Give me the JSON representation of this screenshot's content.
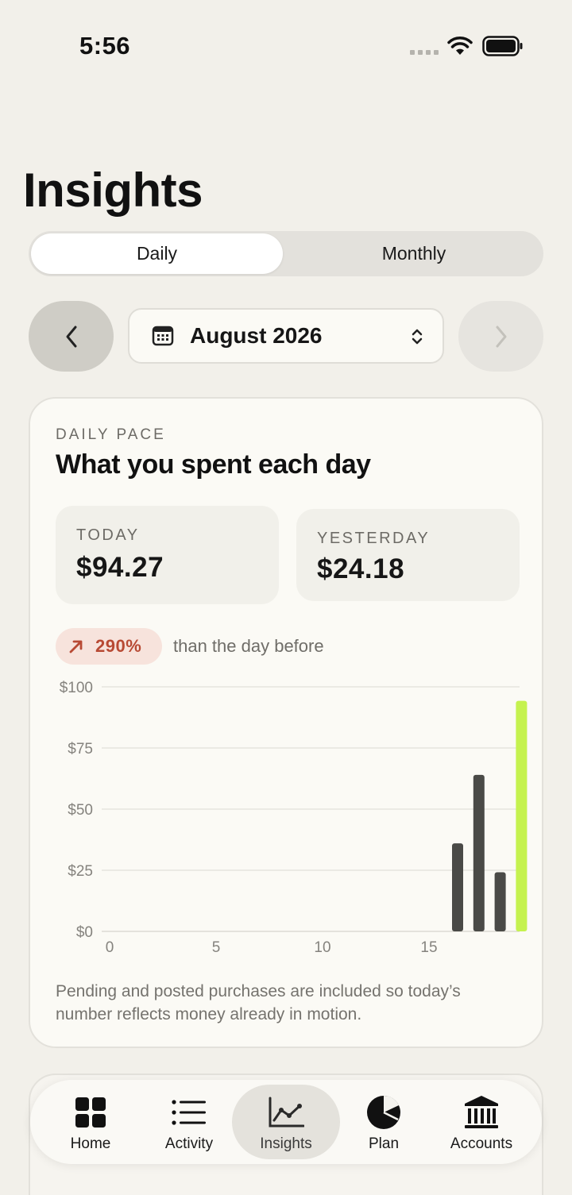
{
  "status_bar": {
    "time": "5:56"
  },
  "page_title": "Insights",
  "segments": {
    "daily": "Daily",
    "monthly": "Monthly",
    "selected": "Daily"
  },
  "month_picker": {
    "label": "August 2026"
  },
  "card": {
    "eyebrow": "DAILY PACE",
    "title": "What you spent each day",
    "today": {
      "label": "TODAY",
      "value": "$94.27"
    },
    "yesterday": {
      "label": "YESTERDAY",
      "value": "$24.18"
    },
    "change": {
      "value": "290%",
      "text": "than the day before",
      "direction": "up"
    },
    "footnote": "Pending and posted purchases are included so today’s number reflects money already in motion."
  },
  "chart_data": {
    "type": "bar",
    "y_ticks": [
      "$100",
      "$75",
      "$50",
      "$25",
      "$0"
    ],
    "x_ticks": [
      "0",
      "5",
      "10",
      "15"
    ],
    "ylim": [
      0,
      100
    ],
    "xlim": [
      0,
      19.5
    ],
    "grid": true,
    "bars": [
      {
        "day": 15,
        "value": 36,
        "color": "#4a4a47"
      },
      {
        "day": 16,
        "value": 64,
        "color": "#4a4a47"
      },
      {
        "day": 17,
        "value": 24.18,
        "color": "#4a4a47"
      },
      {
        "day": 18,
        "value": 94.27,
        "color": "#c5f24f"
      }
    ]
  },
  "tabs": [
    {
      "label": "Home",
      "icon": "grid-icon"
    },
    {
      "label": "Activity",
      "icon": "list-icon"
    },
    {
      "label": "Insights",
      "icon": "line-chart-icon",
      "selected": true
    },
    {
      "label": "Plan",
      "icon": "pie-chart-icon"
    },
    {
      "label": "Accounts",
      "icon": "bank-icon"
    }
  ],
  "colors": {
    "accent": "#c5f24f",
    "bar": "#4a4a47",
    "change": "#b84a34",
    "background": "#f2f0ea"
  }
}
